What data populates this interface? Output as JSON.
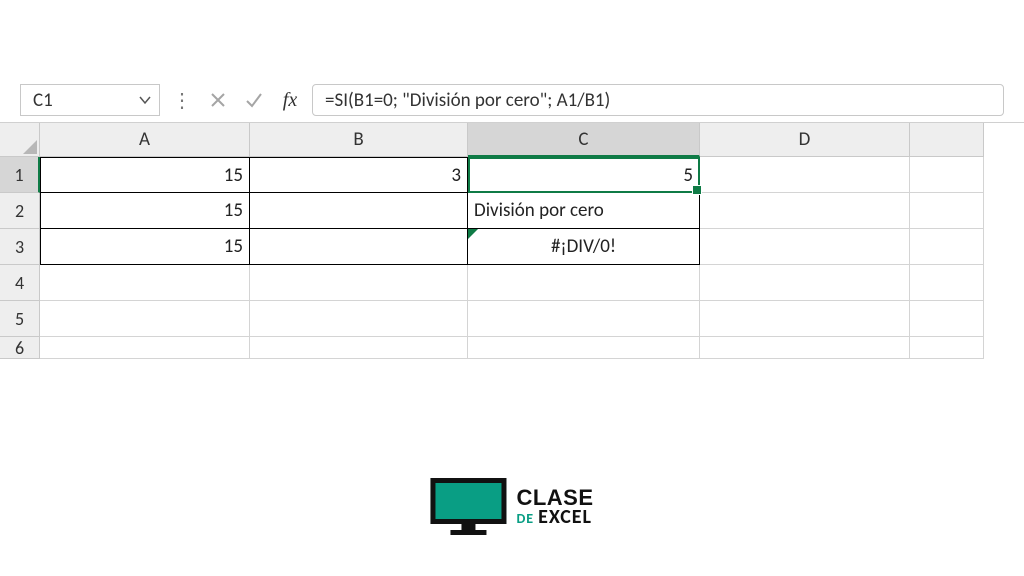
{
  "formulaBar": {
    "nameBox": "C1",
    "formula": "=SI(B1=0; \"División por cero\"; A1/B1)"
  },
  "columns": [
    "A",
    "B",
    "C",
    "D",
    ""
  ],
  "rows": [
    "1",
    "2",
    "3",
    "4",
    "5",
    "6"
  ],
  "cells": {
    "A1": "15",
    "B1": "3",
    "C1": "5",
    "A2": "15",
    "B2": "",
    "C2": "División por cero",
    "A3": "15",
    "B3": "",
    "C3": "#¡DIV/0!"
  },
  "logo": {
    "line1": "CLASE",
    "de": "DE",
    "line2": "EXCEL"
  }
}
